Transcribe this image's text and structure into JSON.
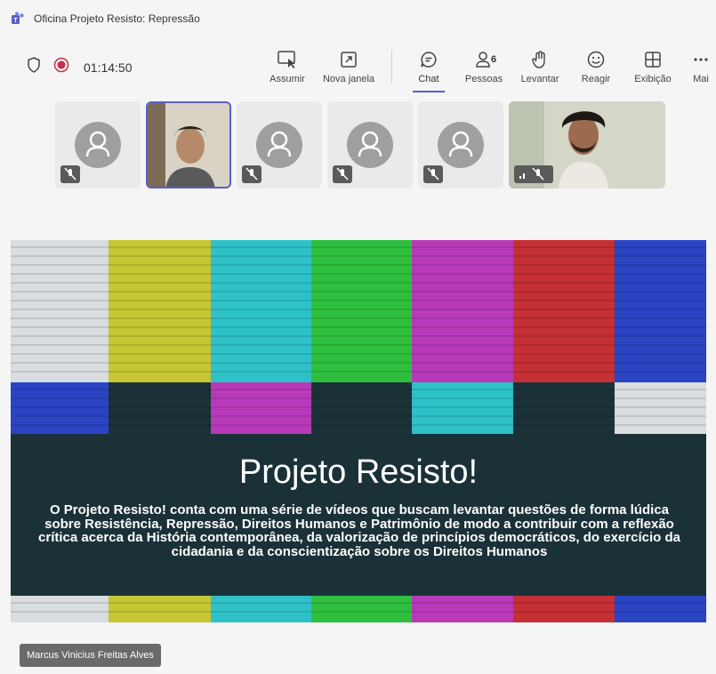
{
  "window": {
    "title": "Oficina Projeto Resisto: Repressão"
  },
  "meeting": {
    "timer": "01:14:50"
  },
  "toolbar": {
    "take_control": "Assumir",
    "new_window": "Nova janela",
    "chat": "Chat",
    "people": "Pessoas",
    "people_count": "6",
    "raise": "Levantar",
    "react": "Reagir",
    "view": "Exibição",
    "more": "Mai"
  },
  "colors": {
    "accent": "#5b5fc7",
    "recording": "#c4314b",
    "slide_bg": "#1b3138"
  },
  "slide": {
    "title": "Projeto Resisto!",
    "body": "O Projeto Resisto! conta com uma série de vídeos que buscam levantar questões de forma lúdica sobre Resistência, Repressão, Direitos Humanos e Patrimônio de modo a contribuir com a reflexão crítica acerca da História contemporânea, da valorização de princípios democráticos, do exercício da cidadania e da conscientização sobre os Direitos Humanos"
  },
  "presenter": {
    "name": "Marcus Vinicius Freitas Alves"
  }
}
